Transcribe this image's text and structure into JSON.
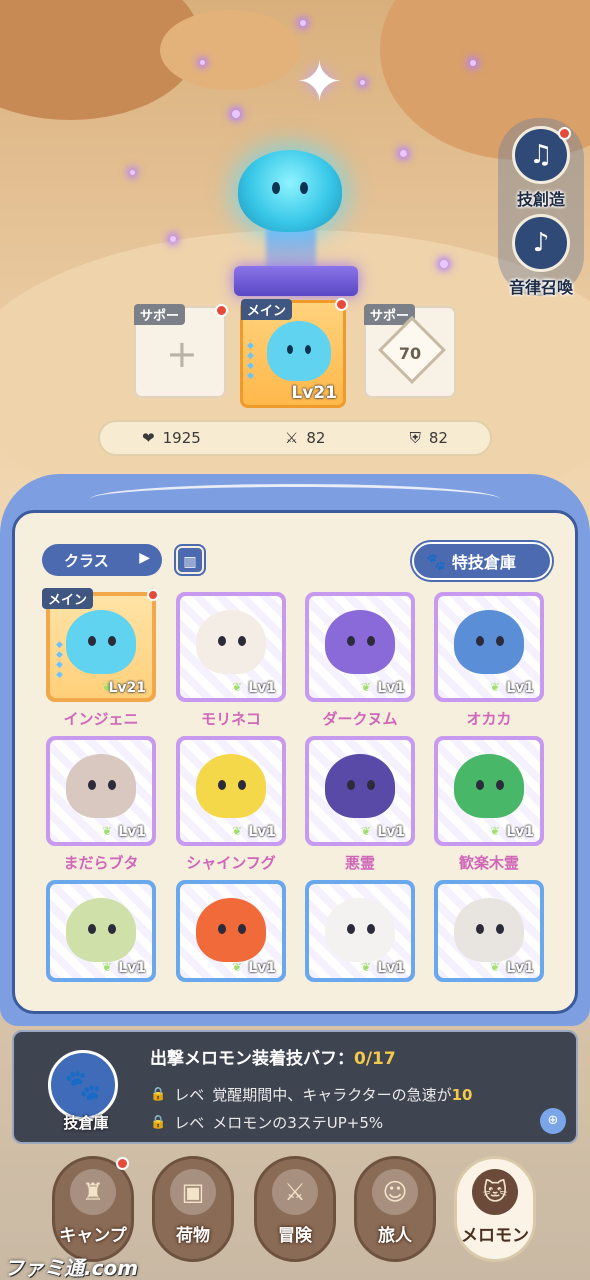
{
  "side_buttons": [
    {
      "label": "技創造",
      "icon": "skill-create-icon",
      "badge": true
    },
    {
      "label": "音律召喚",
      "icon": "harp-summon-icon",
      "badge": false
    }
  ],
  "team": {
    "support_left": {
      "tag": "サポー",
      "badge": true
    },
    "main": {
      "tag": "メイン",
      "level": "Lv21",
      "badge": true
    },
    "support_right": {
      "tag": "サポー",
      "unlock_level": "70"
    }
  },
  "stats": {
    "hp": "1925",
    "attack": "82",
    "defense": "82"
  },
  "panel": {
    "class_button": "クラス",
    "skill_store_button": "特技倉庫"
  },
  "monsters": [
    {
      "name": "インジェニ",
      "level": "Lv21",
      "tag": "メイン",
      "frame": "orange",
      "color": "#5fd3ef"
    },
    {
      "name": "モリネコ",
      "level": "Lv1",
      "frame": "purple",
      "color": "#f4ede6"
    },
    {
      "name": "ダークヌム",
      "level": "Lv1",
      "frame": "purple",
      "color": "#8a6ad8"
    },
    {
      "name": "オカカ",
      "level": "Lv1",
      "frame": "purple",
      "color": "#5a8fd8"
    },
    {
      "name": "まだらブタ",
      "level": "Lv1",
      "frame": "purple",
      "color": "#d8c8c0"
    },
    {
      "name": "シャインフグ",
      "level": "Lv1",
      "frame": "purple",
      "color": "#f4d84a"
    },
    {
      "name": "悪霊",
      "level": "Lv1",
      "frame": "purple",
      "color": "#5a4aa8"
    },
    {
      "name": "歓楽木霊",
      "level": "Lv1",
      "frame": "purple",
      "color": "#48b868"
    },
    {
      "name": "",
      "level": "Lv1",
      "frame": "blue",
      "color": "#cfe0a8"
    },
    {
      "name": "",
      "level": "Lv1",
      "frame": "blue",
      "color": "#f06a3a"
    },
    {
      "name": "",
      "level": "Lv1",
      "frame": "blue",
      "color": "#f4f2f0"
    },
    {
      "name": "",
      "level": "Lv1",
      "frame": "blue",
      "color": "#e8e4e0"
    }
  ],
  "buff": {
    "icon_label": "技倉庫",
    "title": "出撃メロモン装着技バフ：",
    "count": "0/17",
    "line1_prefix": "レベ",
    "line1_text": "覚醒期間中、キャラクターの急速が",
    "line1_value": "10",
    "line2_prefix": "レベ",
    "line2_text": "メロモンの3ステUP+5%"
  },
  "nav": [
    {
      "label": "キャンプ",
      "icon": "castle-icon",
      "badge": true,
      "active": false
    },
    {
      "label": "荷物",
      "icon": "bag-icon",
      "badge": false,
      "active": false
    },
    {
      "label": "冒険",
      "icon": "swords-icon",
      "badge": false,
      "active": false
    },
    {
      "label": "旅人",
      "icon": "character-icon",
      "badge": false,
      "active": false
    },
    {
      "label": "メロモン",
      "icon": "cat-icon",
      "badge": false,
      "active": true
    }
  ],
  "watermark": "ファミ通.com"
}
